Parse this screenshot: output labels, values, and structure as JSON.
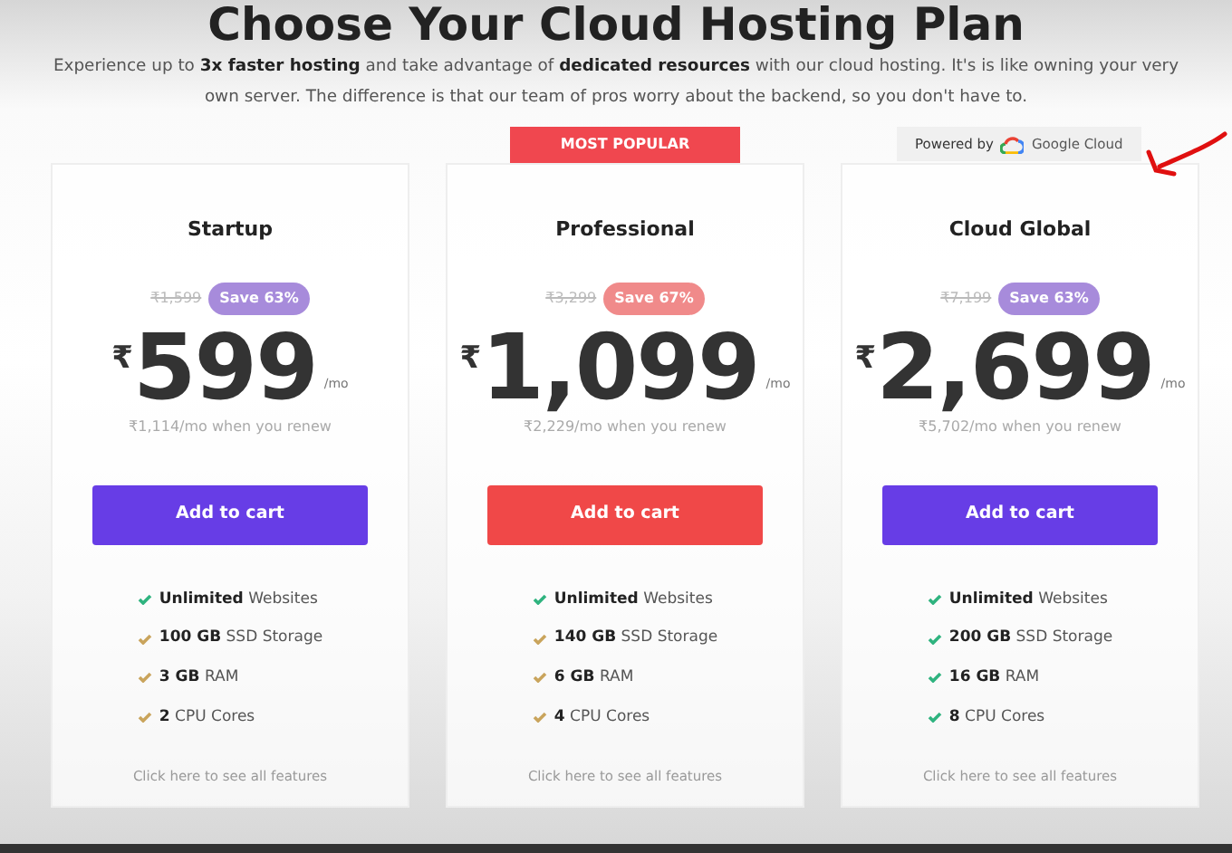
{
  "heading": "Choose Your Cloud Hosting Plan",
  "intro": "Experience up to **3x faster hosting** and take advantage of **dedicated resources** with our cloud hosting. It's is like owning your very own server. The difference is that our team of pros worry about the backend, so you don't have to.",
  "plans": [
    {
      "name": "Startup",
      "highlighted": false,
      "old_price": "₹1,599",
      "save": "Save 63%",
      "currency": "₹",
      "price": "599",
      "per": "/mo",
      "renew": "₹1,114/mo when you renew",
      "button": "Add to cart",
      "features": [
        {
          "text": "**Unlimited** Websites",
          "color": "#2fb37f"
        },
        {
          "text": "**100 GB** SSD Storage",
          "color": "#c9a45c"
        },
        {
          "text": "**3 GB** RAM",
          "color": "#c9a45c"
        },
        {
          "text": "**2** CPU Cores",
          "color": "#c9a45c"
        }
      ],
      "link": "Click here to see all features"
    },
    {
      "name": "Professional",
      "highlighted": true,
      "ribbon": "MOST POPULAR",
      "old_price": "₹3,299",
      "save": "Save 67%",
      "currency": "₹",
      "price": "1,099",
      "per": "/mo",
      "renew": "₹2,229/mo when you renew",
      "button": "Add to cart",
      "features": [
        {
          "text": "**Unlimited** Websites",
          "color": "#2fb37f"
        },
        {
          "text": "**140 GB** SSD Storage",
          "color": "#c9a45c"
        },
        {
          "text": "**6 GB** RAM",
          "color": "#c9a45c"
        },
        {
          "text": "**4** CPU Cores",
          "color": "#c9a45c"
        }
      ],
      "link": "Click here to see all features"
    },
    {
      "name": "Cloud Global",
      "highlighted": false,
      "powered_by": "Powered by",
      "provider": "Google Cloud",
      "old_price": "₹7,199",
      "save": "Save 63%",
      "currency": "₹",
      "price": "2,699",
      "per": "/mo",
      "renew": "₹5,702/mo when you renew",
      "button": "Add to cart",
      "features": [
        {
          "text": "**Unlimited** Websites",
          "color": "#2fb37f"
        },
        {
          "text": "**200 GB** SSD Storage",
          "color": "#2fb37f"
        },
        {
          "text": "**16 GB** RAM",
          "color": "#2fb37f"
        },
        {
          "text": "**8** CPU Cores",
          "color": "#2fb37f"
        }
      ],
      "link": "Click here to see all features"
    }
  ]
}
